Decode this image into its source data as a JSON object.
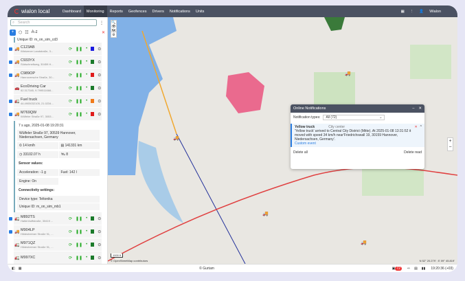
{
  "app": {
    "logo": "wialon local",
    "user": "Wialon"
  },
  "nav": [
    "Dashboard",
    "Monitoring",
    "Reports",
    "Geofences",
    "Drivers",
    "Notifications",
    "Units"
  ],
  "sidebar": {
    "search_placeholder": "Search",
    "az": "A-z",
    "top_uid": "Unique ID: m_on_sim_cd3",
    "units": [
      {
        "name": "C123AB",
        "addr": "Wietzener Landstraße, 3...",
        "color": "#1a1ae0",
        "checked": true,
        "icon": "🚚"
      },
      {
        "name": "C933YX",
        "addr": "Südschnellweg, 30459 H...",
        "color": "#1a7a2a",
        "checked": true,
        "icon": "🚚"
      },
      {
        "name": "C989OP",
        "addr": "Hannoversche Straße, 30...",
        "color": "#e01a1a",
        "checked": true,
        "icon": "🚚"
      },
      {
        "name": "EcoDriving Car",
        "addr": "52.317345, 9.799511666...",
        "color": "#1a7a2a",
        "checked": false,
        "icon": "🚗"
      },
      {
        "name": "Fuel truck",
        "addr": "44.4905032105, 21.0234...",
        "color": "#f07a1a",
        "checked": true,
        "icon": "🚛"
      },
      {
        "name": "M769QW",
        "addr": "Wülfeler Straße 97, 3053...",
        "color": "#e01a1a",
        "checked": true,
        "icon": "🚚"
      }
    ],
    "detail": {
      "time": "7 s ago, 2025-01-08 19:20:31",
      "address": "Wülfeler Straße 97, 30539 Hannover, Niedersachsen, Germany",
      "speed": "14 km/h",
      "mileage": "141331 km",
      "hours": "33102.07 h",
      "sats": "8",
      "sensors_title": "Sensor values:",
      "accel": "Acceleration: -1 g",
      "fuel": "Fuel: 142 l",
      "engine": "Engine: On",
      "conn_title": "Connectivity settings:",
      "device": "Device type: Teltonika",
      "uid": "Unique ID: m_on_sim_mb1"
    },
    "units2": [
      {
        "name": "M892TS",
        "addr": "Haltenhoffstraße, 30419 ...",
        "color": "#1a7a2a",
        "checked": true,
        "icon": "🚛"
      },
      {
        "name": "M904LP",
        "addr": "Hildesheimer Straße 91, ...",
        "color": "#1a7a2a",
        "checked": true,
        "icon": "🚚"
      },
      {
        "name": "M971QZ",
        "addr": "Hildesheimer Straße 91, ...",
        "color": "#1a7a2a",
        "checked": false,
        "icon": "🚛"
      },
      {
        "name": "M997XC",
        "addr": "",
        "color": "#1a7a2a",
        "checked": false,
        "icon": "🚛"
      }
    ]
  },
  "notifications": {
    "title": "Online Notifications",
    "types_label": "Notification types:",
    "types_value": "All (72)",
    "unit": "Yellow truck",
    "zone": "City center",
    "text": "'Yellow truck' arrived to Central City District (Mitte). At 2025-01-08 13:31:52 it moved with speed 34 km/h near'Friedrichswall 19, 30159 Hannover, Niedersachsen, Germany'.",
    "link": "Custom event",
    "delete_all": "Delete all",
    "delete_read": "Delete read"
  },
  "map": {
    "attribution": "© OpenStreetMap contributors",
    "coords": "N 52° 20.279' : E 09° 45.819'",
    "scale": "1000 ft"
  },
  "footer": {
    "copyright": "© Gurtam",
    "badge": "72",
    "time": "19:20:36 (+03)"
  }
}
